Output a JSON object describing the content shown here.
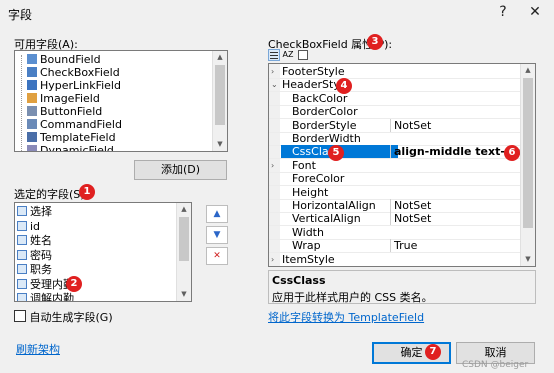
{
  "window": {
    "title": "字段",
    "help_glyph": "?",
    "close_glyph": "✕"
  },
  "available_fields": {
    "label": "可用字段(A):",
    "items": [
      {
        "label": "BoundField",
        "icon": "boundfield-icon"
      },
      {
        "label": "CheckBoxField",
        "icon": "checkbox-icon"
      },
      {
        "label": "HyperLinkField",
        "icon": "hyperlink-icon"
      },
      {
        "label": "ImageField",
        "icon": "image-icon"
      },
      {
        "label": "ButtonField",
        "icon": "button-icon"
      },
      {
        "label": "CommandField",
        "icon": "command-icon"
      },
      {
        "label": "TemplateField",
        "icon": "template-icon"
      },
      {
        "label": "DynamicField",
        "icon": "dynamic-icon"
      }
    ],
    "add_button": "添加(D)"
  },
  "selected_fields": {
    "label": "选定的字段(S):",
    "items": [
      "选择",
      "id",
      "姓名",
      "密码",
      "职务",
      "受理内勤",
      "调解内勤"
    ],
    "up_glyph": "▲",
    "down_glyph": "▼",
    "delete_glyph": "✕"
  },
  "auto_generate": {
    "label": "自动生成字段(G)",
    "checked": false
  },
  "refresh_link": "刷新架构",
  "properties": {
    "title": "CheckBoxField 属性(P):",
    "toolbar": {
      "categorized": "categorized-icon",
      "alphabetical": "alphabetical-icon",
      "pages": "property-pages-icon"
    },
    "rows": [
      {
        "name": "FooterStyle",
        "value": "",
        "expander": "›",
        "indent": false
      },
      {
        "name": "HeaderStyle",
        "value": "",
        "expander": "⌄",
        "indent": false
      },
      {
        "name": "BackColor",
        "value": "",
        "expander": "",
        "indent": true
      },
      {
        "name": "BorderColor",
        "value": "",
        "expander": "",
        "indent": true
      },
      {
        "name": "BorderStyle",
        "value": "NotSet",
        "expander": "",
        "indent": true
      },
      {
        "name": "BorderWidth",
        "value": "",
        "expander": "",
        "indent": true
      },
      {
        "name": "CssClass",
        "value": "align-middle text-center",
        "expander": "",
        "indent": true,
        "selected": true
      },
      {
        "name": "Font",
        "value": "",
        "expander": "›",
        "indent": true
      },
      {
        "name": "ForeColor",
        "value": "",
        "expander": "",
        "indent": true
      },
      {
        "name": "Height",
        "value": "",
        "expander": "",
        "indent": true
      },
      {
        "name": "HorizontalAlign",
        "value": "NotSet",
        "expander": "",
        "indent": true
      },
      {
        "name": "VerticalAlign",
        "value": "NotSet",
        "expander": "",
        "indent": true
      },
      {
        "name": "Width",
        "value": "",
        "expander": "",
        "indent": true
      },
      {
        "name": "Wrap",
        "value": "True",
        "expander": "",
        "indent": true
      },
      {
        "name": "ItemStyle",
        "value": "",
        "expander": "›",
        "indent": false
      }
    ],
    "description_title": "CssClass",
    "description_text": "应用于此样式用户的 CSS 类名。",
    "convert_link": "将此字段转换为 TemplateField"
  },
  "buttons": {
    "ok": "确定",
    "cancel": "取消"
  },
  "badges": [
    "1",
    "2",
    "3",
    "4",
    "5",
    "6",
    "7"
  ],
  "watermark": "CSDN @beiger",
  "colors": {
    "badge": "#e02020",
    "selection": "#0078d7",
    "link": "#0066cc"
  }
}
